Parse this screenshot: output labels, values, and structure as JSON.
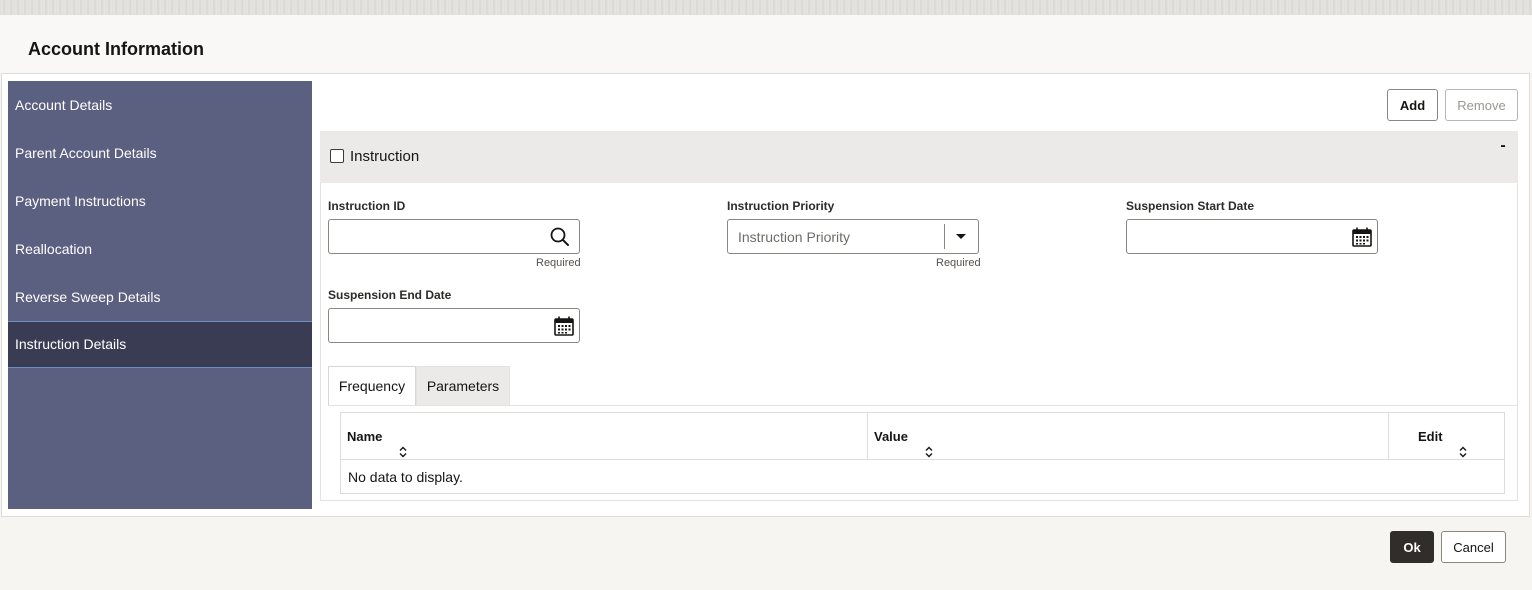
{
  "page": {
    "title": "Account Information"
  },
  "sidebar": {
    "items": [
      {
        "label": "Account Details"
      },
      {
        "label": "Parent Account Details"
      },
      {
        "label": "Payment Instructions"
      },
      {
        "label": "Reallocation"
      },
      {
        "label": "Reverse Sweep Details"
      },
      {
        "label": "Instruction Details"
      }
    ],
    "active": "Instruction Details"
  },
  "toolbar": {
    "add_label": "Add",
    "remove_label": "Remove"
  },
  "section": {
    "title": "Instruction",
    "collapse_symbol": "-"
  },
  "form": {
    "instruction_id": {
      "label": "Instruction ID",
      "value": "",
      "required_text": "Required"
    },
    "instruction_priority": {
      "label": "Instruction Priority",
      "placeholder": "Instruction Priority",
      "value": "",
      "required_text": "Required"
    },
    "suspension_start_date": {
      "label": "Suspension Start Date",
      "value": ""
    },
    "suspension_end_date": {
      "label": "Suspension End Date",
      "value": ""
    }
  },
  "tabs": [
    {
      "label": "Frequency",
      "active": true
    },
    {
      "label": "Parameters",
      "active": false
    }
  ],
  "table": {
    "columns": [
      {
        "label": "Name"
      },
      {
        "label": "Value"
      },
      {
        "label": "Edit"
      }
    ],
    "empty_message": "No data to display."
  },
  "footer": {
    "ok_label": "Ok",
    "cancel_label": "Cancel"
  },
  "icons": {
    "search": "search-icon",
    "dropdown": "caret-down-icon",
    "calendar": "calendar-icon",
    "sort": "sort-icon"
  },
  "colors": {
    "sidebar_bg": "#5b5f80",
    "sidebar_active_bg": "#3a3c54",
    "primary_button": "#312d2a"
  }
}
